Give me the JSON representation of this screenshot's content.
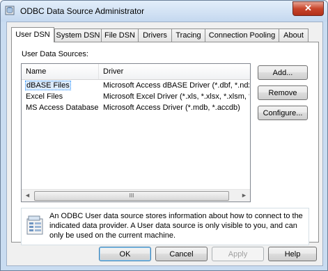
{
  "window": {
    "title": "ODBC Data Source Administrator",
    "close_label": "✕"
  },
  "tabs": [
    {
      "label": "User DSN"
    },
    {
      "label": "System DSN"
    },
    {
      "label": "File DSN"
    },
    {
      "label": "Drivers"
    },
    {
      "label": "Tracing"
    },
    {
      "label": "Connection Pooling"
    },
    {
      "label": "About"
    }
  ],
  "panel": {
    "section_label": "User Data Sources:",
    "columns": [
      "Name",
      "Driver"
    ],
    "rows": [
      {
        "name": "dBASE Files",
        "driver": "Microsoft Access dBASE Driver (*.dbf, *.ndx"
      },
      {
        "name": "Excel Files",
        "driver": "Microsoft Excel Driver (*.xls, *.xlsx, *.xlsm, *.x"
      },
      {
        "name": "MS Access Database",
        "driver": "Microsoft Access Driver (*.mdb, *.accdb)"
      }
    ],
    "scroll_left": "◄",
    "scroll_right": "►",
    "scroll_grip": "III",
    "buttons": {
      "add": "Add...",
      "remove": "Remove",
      "configure": "Configure..."
    },
    "info_text": "An ODBC User data source stores information about how to connect to the indicated data provider.   A User data source is only visible to you, and can only be used on the current machine."
  },
  "footer": {
    "ok": "OK",
    "cancel": "Cancel",
    "apply": "Apply",
    "help": "Help"
  },
  "colors": {
    "selection": "#dcebfc",
    "accent": "#3399ff",
    "frame": "#c9dcf1"
  },
  "icons": {
    "app": "odbc-app-icon",
    "info": "datasource-info-icon"
  }
}
